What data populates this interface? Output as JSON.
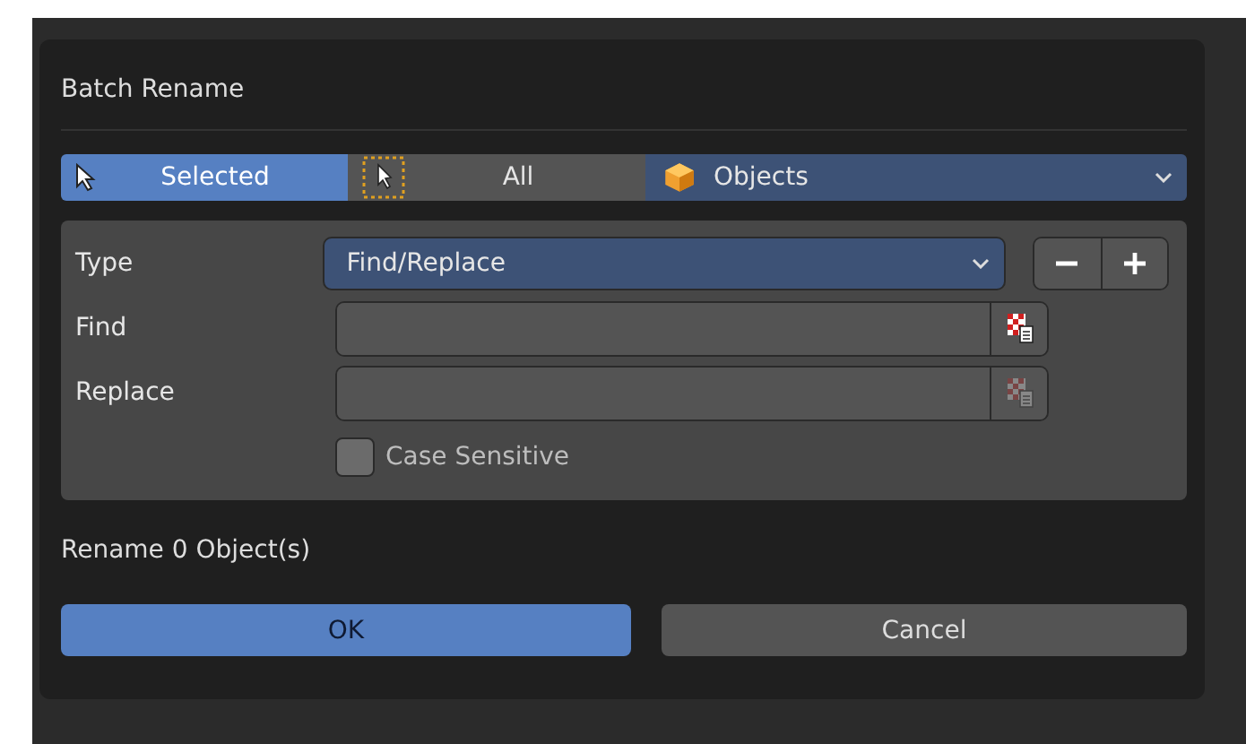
{
  "dialog": {
    "title": "Batch Rename"
  },
  "scope_tabs": [
    {
      "label": "Selected",
      "selected": true
    },
    {
      "label": "All",
      "selected": false
    }
  ],
  "data_type": {
    "value": "Objects"
  },
  "rows": [
    {
      "kind": "dropdown",
      "label": "Type",
      "value": "Find/Replace"
    },
    {
      "kind": "text",
      "label": "Find",
      "icon_disabled": false
    },
    {
      "kind": "text",
      "label": "Replace",
      "icon_disabled": true
    }
  ],
  "case_sensitive": {
    "label": "Case Sensitive",
    "checked": false
  },
  "status": "Rename 0 Object(s)",
  "buttons": [
    {
      "label": "OK",
      "kind": "primary"
    },
    {
      "label": "Cancel",
      "kind": "secondary"
    }
  ]
}
